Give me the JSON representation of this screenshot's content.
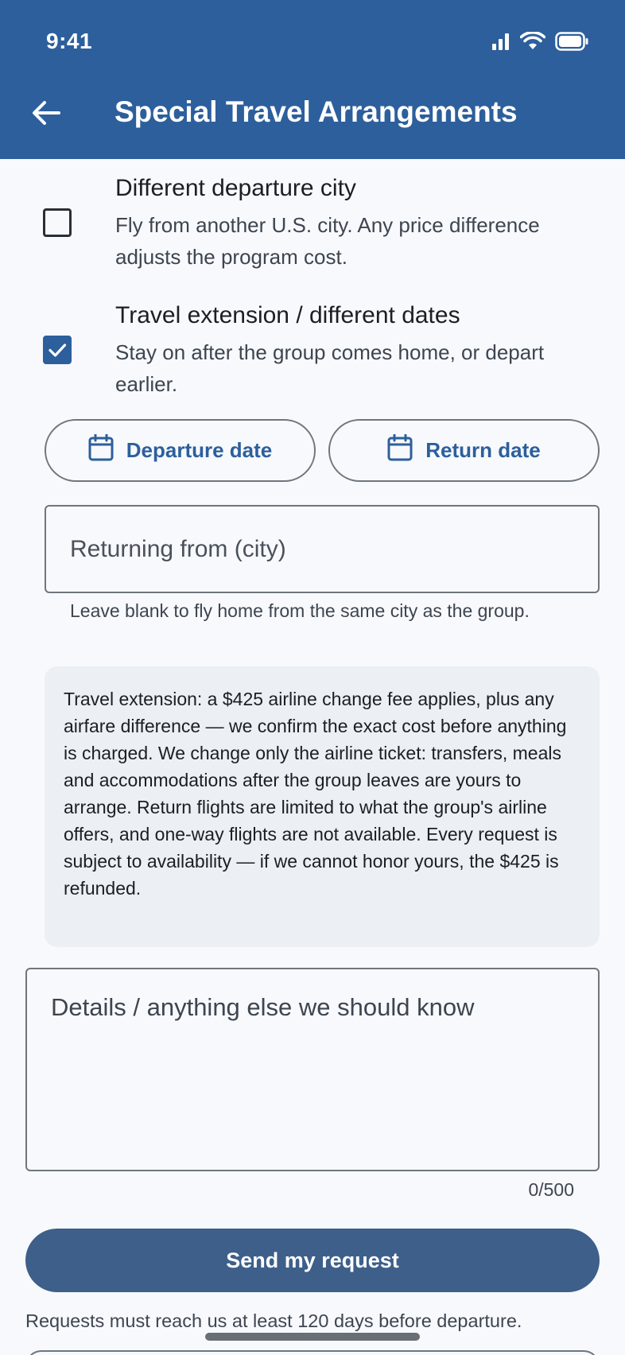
{
  "status_bar": {
    "time": "9:41"
  },
  "app_bar": {
    "title": "Special Travel Arrangements"
  },
  "options": [
    {
      "title": "Different departure city",
      "description": "Fly from another U.S. city. Any price difference adjusts the program cost.",
      "checked": false
    },
    {
      "title": "Travel extension / different dates",
      "description": "Stay on after the group comes home, or depart earlier.",
      "checked": true
    }
  ],
  "dates": {
    "departure_label": "Departure date",
    "return_label": "Return date"
  },
  "returning_city": {
    "placeholder": "Returning from (city)",
    "value": "",
    "helper": "Leave blank to fly home from the same city as the group."
  },
  "notice": {
    "text": "Travel extension: a $425 airline change fee applies, plus any airfare difference — we confirm the exact cost before anything is charged. We change only the airline ticket: transfers, meals and accommodations after the group leaves are yours to arrange. Return flights are limited to what the group's airline offers, and one-way flights are not available. Every request is subject to availability — if we cannot honor yours, the $425 is refunded."
  },
  "details": {
    "placeholder": "Details / anything else we should know",
    "value": "",
    "counter": "0/500"
  },
  "submit": {
    "label": "Send my request"
  },
  "footnote": "Requests must reach us at least 120 days before departure.",
  "colors": {
    "primary": "#2d5f9c",
    "button": "#3d5f8a",
    "background": "#f7f9fc",
    "notice_bg": "#eceff4"
  },
  "icons": {
    "back": "arrow-left-icon",
    "calendar": "calendar-icon",
    "signal": "signal-icon",
    "wifi": "wifi-icon",
    "battery": "battery-icon",
    "check": "check-icon"
  }
}
